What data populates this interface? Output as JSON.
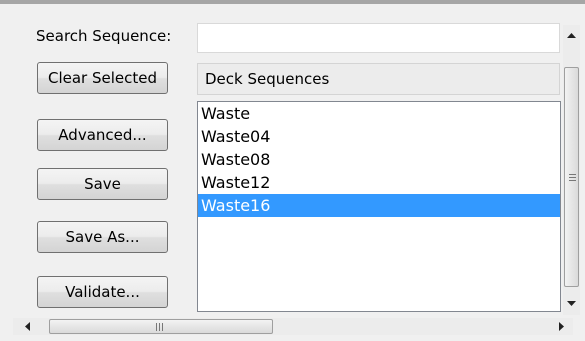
{
  "search": {
    "label": "Search Sequence:",
    "value": ""
  },
  "buttons": {
    "clear_selected": "Clear Selected",
    "advanced": "Advanced...",
    "save": "Save",
    "save_as": "Save As...",
    "validate": "Validate..."
  },
  "deck": {
    "header": "Deck Sequences",
    "items": [
      "Waste",
      "Waste04",
      "Waste08",
      "Waste12",
      "Waste16"
    ],
    "selected": "Waste16"
  },
  "colors": {
    "selection": "#3399ff",
    "panel": "#f0f0f0"
  },
  "icons": [
    "scroll-up-arrow-icon",
    "scroll-down-arrow-icon",
    "scroll-left-arrow-icon",
    "scroll-right-arrow-icon"
  ]
}
